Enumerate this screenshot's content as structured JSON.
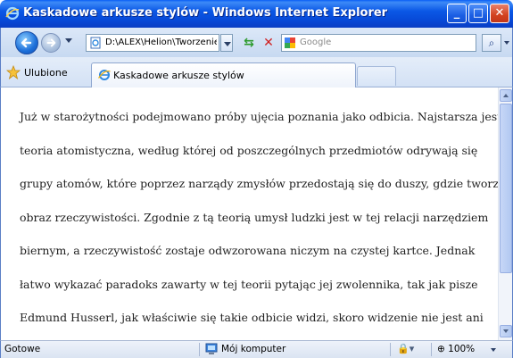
{
  "window": {
    "title": "Kaskadowe arkusze stylów - Windows Internet Explorer",
    "buttons": {
      "minimize": "_",
      "maximize": "□",
      "close": "✕"
    }
  },
  "nav": {
    "address": "D:\\ALEX\\Helion\\Tworzenie",
    "search_placeholder": "Google",
    "search_icon": "magnifier-icon",
    "refresh_icon": "refresh-icon",
    "stop_icon": "stop-icon"
  },
  "favorites": {
    "label": "Ulubione"
  },
  "tabs": [
    {
      "label": "Kaskadowe arkusze stylów"
    }
  ],
  "content": {
    "lines": [
      "Już w starożytności podejmowano próby ujęcia poznania jako odbicia. Najstarsza jest",
      "teoria atomistyczna, według której od poszczególnych przedmiotów odrywają się",
      "grupy atomów, które poprzez narządy zmysłów przedostają się do duszy, gdzie tworzą",
      "obraz rzeczywistości. Zgodnie z tą teorią umysł ludzki jest w tej relacji narzędziem",
      "biernym, a rzeczywistość zostaje odwzorowana niczym na czystej kartce. Jednak",
      "łatwo wykazać paradoks zawarty w tej teorii pytając jej zwolennika, tak jak pisze",
      "Edmund Husserl, jak właściwie się takie odbicie widzi, skoro widzenie nie jest ani"
    ]
  },
  "status": {
    "text": "Gotowe",
    "zone": "Mój komputer",
    "zoom": "100%"
  },
  "colors": {
    "titlebar": "#0b58e6",
    "accent": "#5b7fc6"
  }
}
